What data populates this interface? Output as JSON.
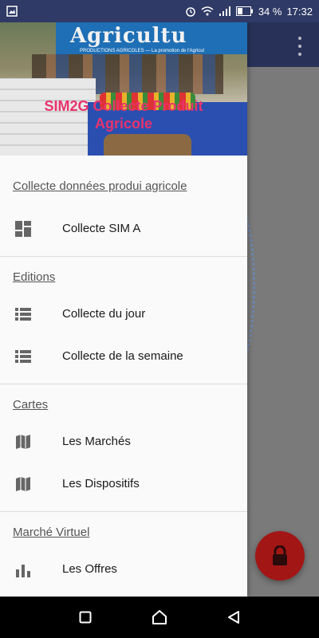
{
  "status_bar": {
    "battery_percent": "34 %",
    "time": "17:32",
    "icons": [
      "image-icon",
      "alarm-icon",
      "wifi-icon",
      "signal-icon",
      "battery-icon"
    ]
  },
  "drawer": {
    "header_title": "SIM2G Collecte Produit Agricole",
    "header_banner_text": "Agricultu",
    "header_banner_sub": "PRODUCTIONS AGRICOLES — La promotion de l'Agricul",
    "sections": [
      {
        "title": "Collecte données produi agricole",
        "items": [
          {
            "label": "Collecte SIM A",
            "icon": "dashboard-icon"
          }
        ]
      },
      {
        "title": "Editions",
        "items": [
          {
            "label": "Collecte du jour",
            "icon": "list-icon"
          },
          {
            "label": "Collecte de la semaine",
            "icon": "list-icon"
          }
        ]
      },
      {
        "title": "Cartes",
        "items": [
          {
            "label": "Les Marchés",
            "icon": "map-icon"
          },
          {
            "label": "Les Dispositifs",
            "icon": "map-icon"
          }
        ]
      },
      {
        "title": "Marché Virtuel",
        "items": [
          {
            "label": "Les Offres",
            "icon": "bar-chart-icon"
          }
        ]
      }
    ]
  },
  "colors": {
    "status_bar": "#2f3a66",
    "app_bar": "#283259",
    "header_title": "#e8336e",
    "fab": "#a31616"
  }
}
